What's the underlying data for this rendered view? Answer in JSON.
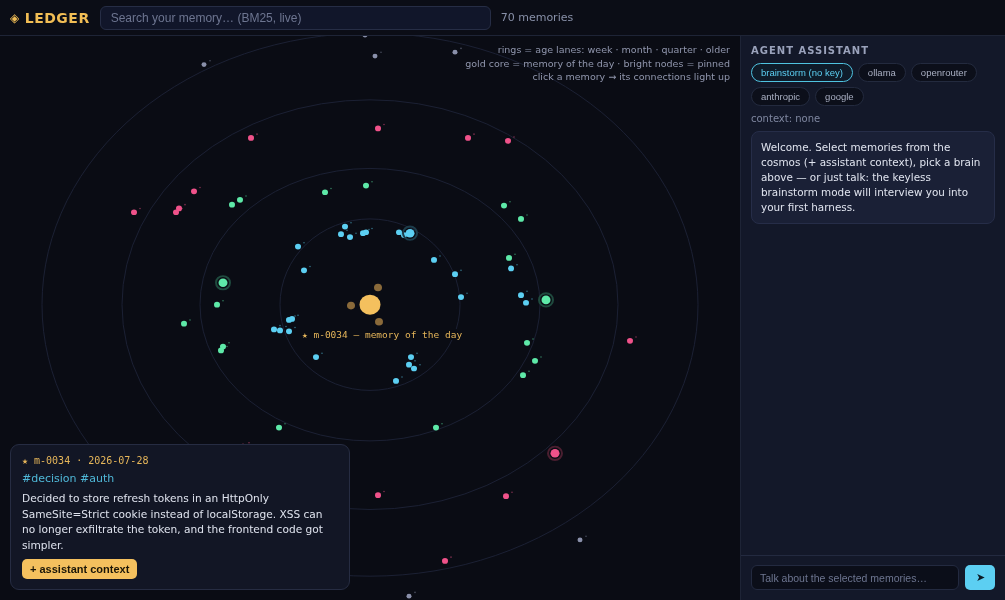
{
  "app": {
    "logo": "◈",
    "name": "LEDGER"
  },
  "search": {
    "placeholder": "Search your memory… (BM25, live)"
  },
  "memory_count": "70 memories",
  "cosmos": {
    "legend": [
      "rings = age lanes: week · month · quarter · older",
      "gold core = memory of the day · bright nodes = pinned",
      "click a memory → its connections light up"
    ],
    "core_label": "★ m-0034 — memory of the day"
  },
  "memory_card": {
    "header": "★ m-0034 · 2026-07-28",
    "tags": "#decision #auth",
    "body": "Decided to store refresh tokens in an HttpOnly SameSite=Strict cookie instead of localStorage. XSS can no longer exfiltrate the token, and the frontend code got simpler.",
    "button": "+ assistant context"
  },
  "assistant": {
    "title": "AGENT ASSISTANT",
    "providers": [
      {
        "label": "brainstorm (no key)",
        "selected": true
      },
      {
        "label": "ollama",
        "selected": false
      },
      {
        "label": "openrouter",
        "selected": false
      },
      {
        "label": "anthropic",
        "selected": false
      },
      {
        "label": "google",
        "selected": false
      }
    ],
    "context": "context: none",
    "messages": [
      {
        "text": "Welcome. Select memories from the cosmos (+ assistant context), pick a brain above — or just talk: the keyless brainstorm mode will interview you into your first harness."
      }
    ],
    "input": {
      "placeholder": "Talk about the selected memories…"
    },
    "send": "➤"
  }
}
